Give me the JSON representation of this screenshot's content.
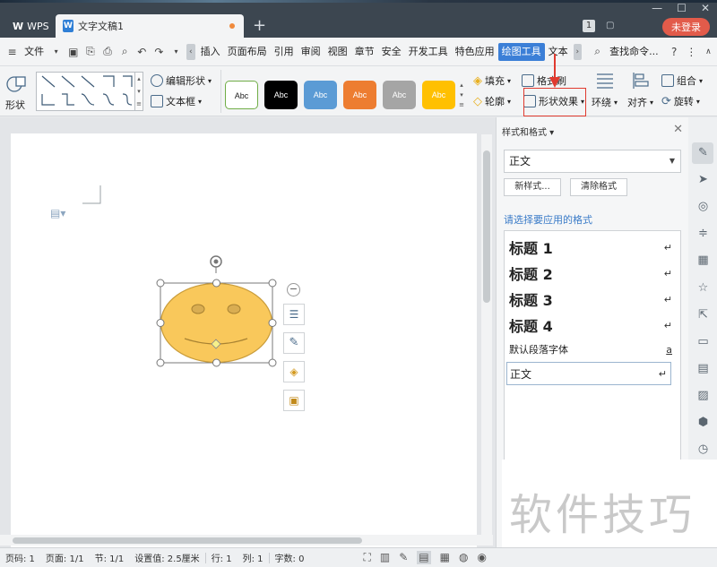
{
  "titlebar": {
    "app_tab": "WPS",
    "doc_tab": "文字文稿1",
    "badge": "1",
    "login_label": "未登录"
  },
  "menubar": {
    "file_label": "文件",
    "items": [
      "插入",
      "页面布局",
      "引用",
      "审阅",
      "视图",
      "章节",
      "安全",
      "开发工具",
      "特色应用",
      "绘图工具",
      "文本"
    ],
    "active_item": "绘图工具",
    "search_label": "查找命令..."
  },
  "ribbon": {
    "shape_label": "形状",
    "edit_shape_label": "编辑形状",
    "textbox_label": "文本框",
    "style_samples": [
      "Abc",
      "Abc",
      "Abc",
      "Abc",
      "Abc",
      "Abc"
    ],
    "style_colors": [
      "#ffffff",
      "#000000",
      "#5b9bd5",
      "#ed7d31",
      "#a5a5a5",
      "#ffc000"
    ],
    "fill_label": "填充",
    "format_brush_label": "格式刷",
    "outline_label": "轮廓",
    "shape_effect_label": "形状效果",
    "wrap_label": "环绕",
    "align_label": "对齐",
    "group_label": "组合",
    "rotate_label": "旋转"
  },
  "panel": {
    "title": "样式和格式",
    "current_style": "正文",
    "new_style_button": "新样式...",
    "clear_format_button": "清除格式",
    "apply_label": "请选择要应用的格式",
    "styles": [
      {
        "name": "标题 1",
        "marker": "↵"
      },
      {
        "name": "标题 2",
        "marker": "↵"
      },
      {
        "name": "标题 3",
        "marker": "↵"
      },
      {
        "name": "标题 4",
        "marker": "↵"
      },
      {
        "name": "默认段落字体",
        "marker": "a"
      },
      {
        "name": "正文",
        "marker": "↵"
      }
    ]
  },
  "watermark": "软件技巧",
  "status": {
    "page_no": "页码: 1",
    "pages": "页面: 1/1",
    "section": "节: 1/1",
    "setting": "设置值: 2.5厘米",
    "row": "行: 1",
    "col": "列: 1",
    "words": "字数: 0"
  },
  "colors": {
    "accent": "#3b7fd7",
    "smiley_fill": "#f9c85b",
    "smiley_stroke": "#d4a33c",
    "highlight_red": "#e03a2f"
  }
}
